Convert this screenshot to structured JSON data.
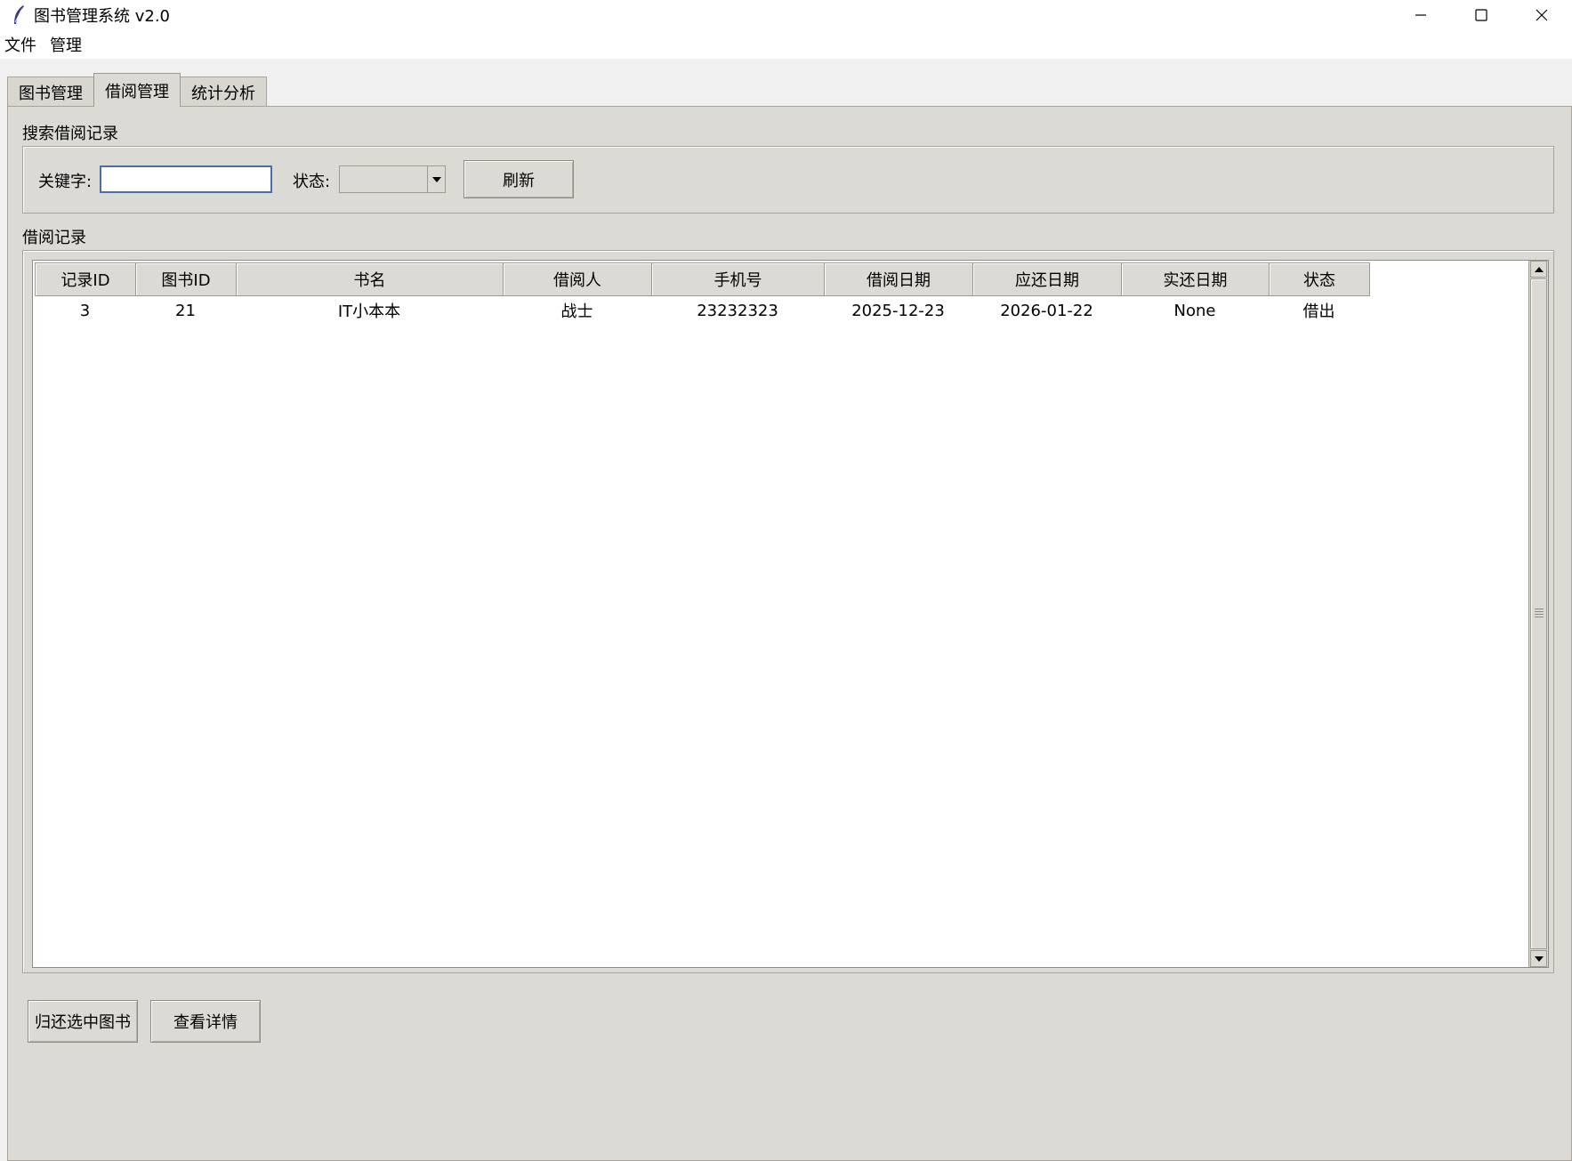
{
  "window": {
    "title": "图书管理系统 v2.0",
    "icon": "feather-icon"
  },
  "menu": {
    "items": [
      {
        "label": "文件"
      },
      {
        "label": "管理"
      }
    ]
  },
  "tabs": [
    {
      "label": "图书管理",
      "active": false
    },
    {
      "label": "借阅管理",
      "active": true
    },
    {
      "label": "统计分析",
      "active": false
    }
  ],
  "search": {
    "section_title": "搜索借阅记录",
    "keyword_label": "关键字:",
    "keyword_value": "",
    "status_label": "状态:",
    "status_value": "",
    "refresh_label": "刷新"
  },
  "records": {
    "section_title": "借阅记录",
    "columns": [
      "记录ID",
      "图书ID",
      "书名",
      "借阅人",
      "手机号",
      "借阅日期",
      "应还日期",
      "实还日期",
      "状态"
    ],
    "rows": [
      [
        "3",
        "21",
        "IT小本本",
        "战士",
        "23232323",
        "2025-12-23",
        "2026-01-22",
        "None",
        "借出"
      ]
    ]
  },
  "actions": {
    "return_label": "归还选中图书",
    "details_label": "查看详情"
  },
  "colors": {
    "panel_bg": "#dcdad5",
    "input_focus_border": "#4a6fa5"
  }
}
